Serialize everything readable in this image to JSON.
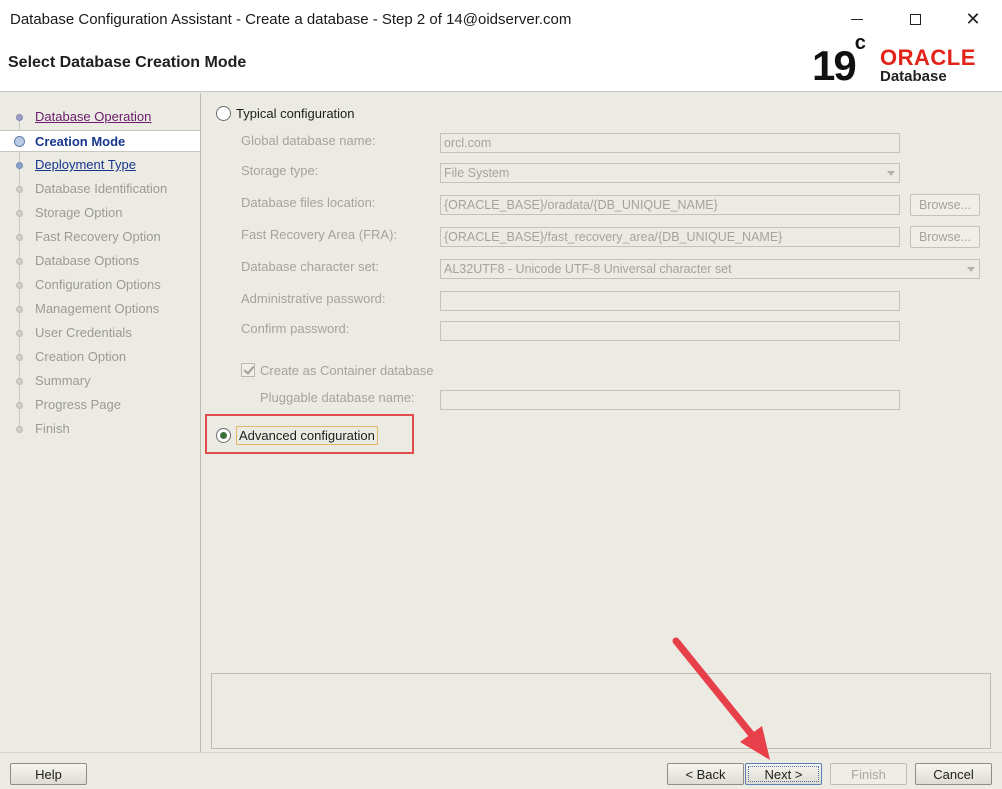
{
  "window": {
    "title": "Database Configuration Assistant - Create a database - Step 2 of 14@oidserver.com"
  },
  "header": {
    "page_title": "Select Database Creation Mode",
    "logo_version": "19",
    "logo_version_sup": "c",
    "logo_brand": "ORACLE",
    "logo_product": "Database"
  },
  "sidebar": {
    "steps": [
      {
        "label": "Database Operation",
        "state": "done"
      },
      {
        "label": "Creation Mode",
        "state": "current"
      },
      {
        "label": "Deployment Type",
        "state": "link"
      },
      {
        "label": "Database Identification",
        "state": "disabled"
      },
      {
        "label": "Storage Option",
        "state": "disabled"
      },
      {
        "label": "Fast Recovery Option",
        "state": "disabled"
      },
      {
        "label": "Database Options",
        "state": "disabled"
      },
      {
        "label": "Configuration Options",
        "state": "disabled"
      },
      {
        "label": "Management Options",
        "state": "disabled"
      },
      {
        "label": "User Credentials",
        "state": "disabled"
      },
      {
        "label": "Creation Option",
        "state": "disabled"
      },
      {
        "label": "Summary",
        "state": "disabled"
      },
      {
        "label": "Progress Page",
        "state": "disabled"
      },
      {
        "label": "Finish",
        "state": "disabled"
      }
    ]
  },
  "form": {
    "typical_label": "Typical configuration",
    "global_db_name_label": "Global database name:",
    "global_db_name_value": "orcl.com",
    "storage_type_label": "Storage type:",
    "storage_type_value": "File System",
    "db_files_location_label": "Database files location:",
    "db_files_location_value": "{ORACLE_BASE}/oradata/{DB_UNIQUE_NAME}",
    "fra_label": "Fast Recovery Area (FRA):",
    "fra_value": "{ORACLE_BASE}/fast_recovery_area/{DB_UNIQUE_NAME}",
    "browse_label": "Browse...",
    "charset_label": "Database character set:",
    "charset_value": "AL32UTF8 - Unicode UTF-8 Universal character set",
    "admin_password_label": "Administrative password:",
    "confirm_password_label": "Confirm password:",
    "container_db_label": "Create as Container database",
    "pluggable_db_label": "Pluggable database name:",
    "advanced_label": "Advanced configuration",
    "selected_mode": "Advanced configuration"
  },
  "footer": {
    "help": "Help",
    "back": "< Back",
    "next": "Next >",
    "finish": "Finish",
    "cancel": "Cancel"
  },
  "colors": {
    "annotation_red": "#e8404a",
    "oracle_red": "#e2231a"
  }
}
